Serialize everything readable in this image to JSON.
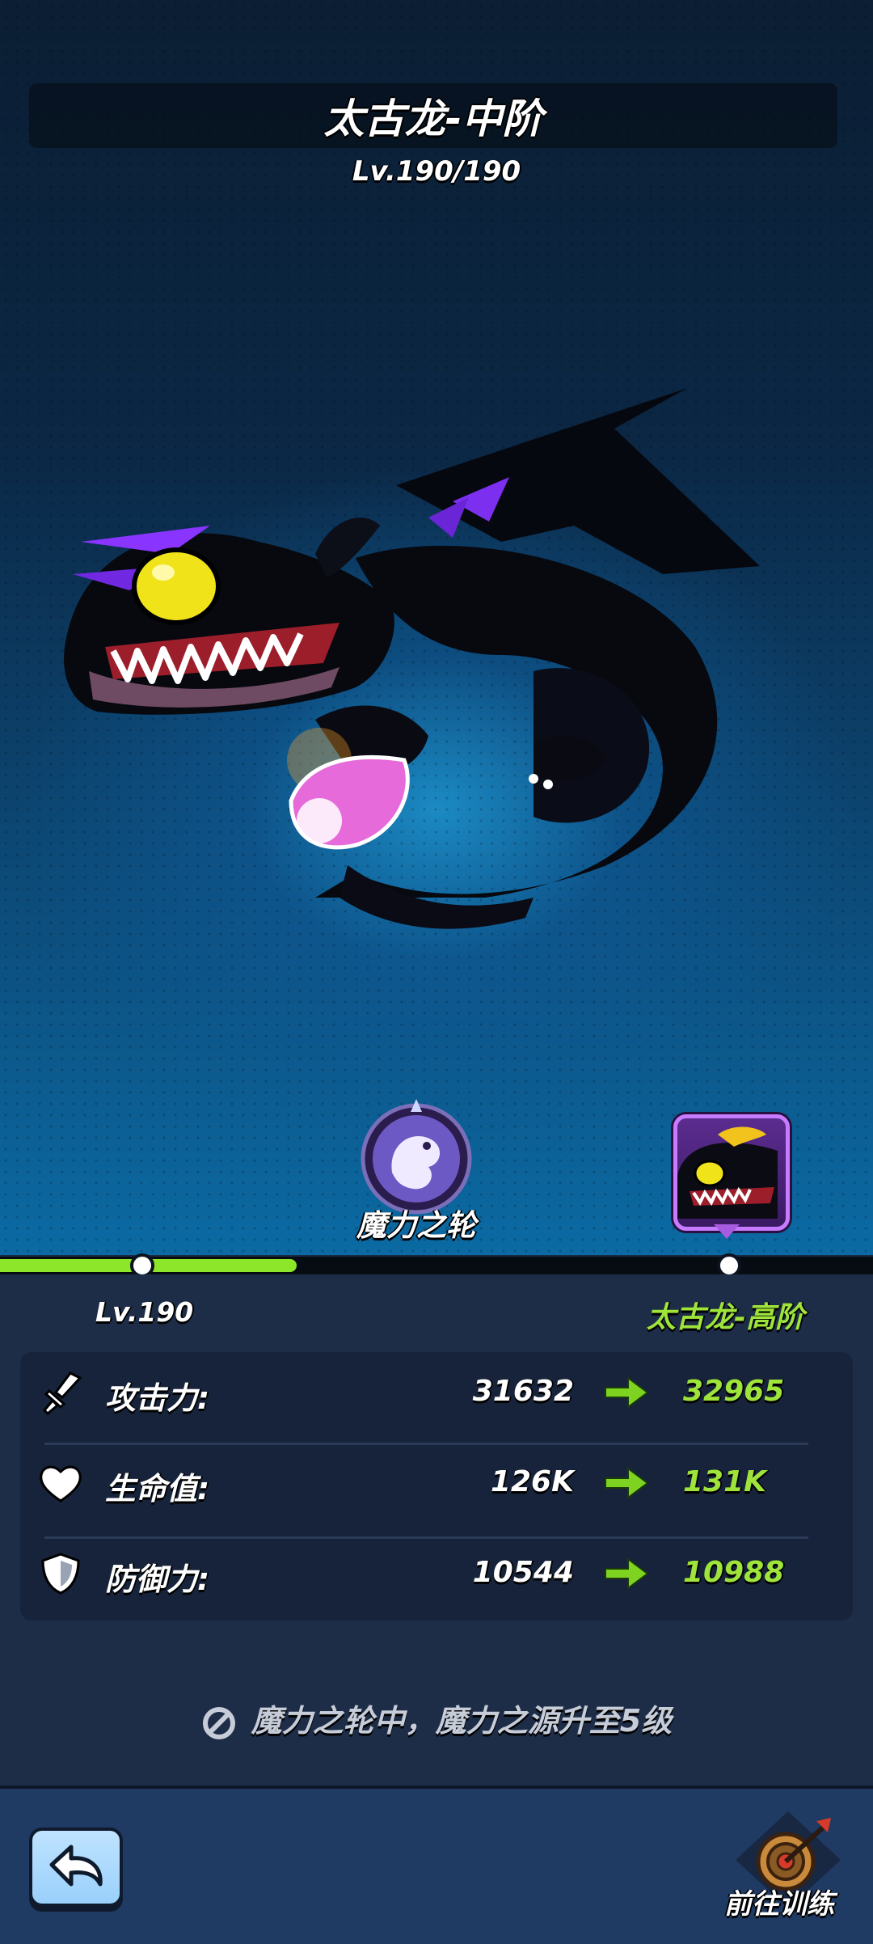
{
  "header": {
    "title": "太古龙-中阶",
    "level": "Lv.190/190"
  },
  "scene": {
    "pet_image": "dark-dragon-illustration",
    "wheel_icon": "magic-wheel-icon",
    "wheel_label": "魔力之轮",
    "next_stage_icon": "dragon-portrait-icon"
  },
  "progress": {
    "fill_fraction": 0.34
  },
  "upgrade": {
    "current_level": "Lv.190",
    "next_stage_name": "太古龙-高阶"
  },
  "stats": [
    {
      "label": "攻击力:",
      "current": "31632",
      "next": "32965",
      "icon": "sword-icon"
    },
    {
      "label": "生命值:",
      "current": "126K",
      "next": "131K",
      "icon": "heart-icon"
    },
    {
      "label": "防御力:",
      "current": "10544",
      "next": "10988",
      "icon": "shield-icon"
    }
  ],
  "requirement": {
    "text": "魔力之轮中，魔力之源升至5级",
    "icon": "forbidden-icon"
  },
  "bottom_bar": {
    "back_icon": "back-arrow-icon",
    "train_label": "前往训练",
    "train_icon": "target-icon"
  },
  "colors": {
    "accent_green": "#9ee43a",
    "panel_bg": "#1e2d47",
    "stat_box_bg": "#17233a"
  }
}
